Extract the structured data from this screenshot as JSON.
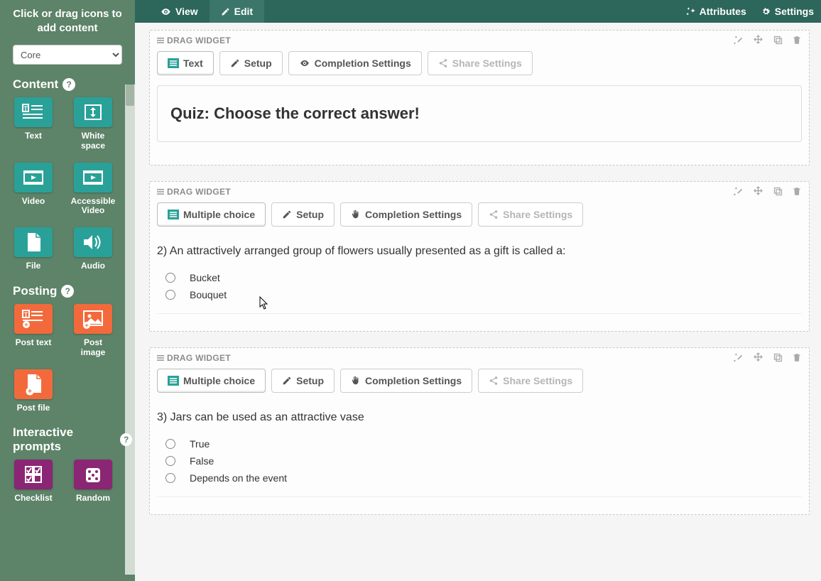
{
  "sidebar": {
    "header": "Click or drag icons to add content",
    "select_value": "Core",
    "sections": [
      {
        "title": "Content",
        "items": [
          {
            "label": "Text",
            "color": "teal"
          },
          {
            "label": "White space",
            "color": "teal"
          },
          {
            "label": "Video",
            "color": "teal"
          },
          {
            "label": "Accessible Video",
            "color": "teal"
          },
          {
            "label": "File",
            "color": "teal"
          },
          {
            "label": "Audio",
            "color": "teal"
          }
        ]
      },
      {
        "title": "Posting",
        "items": [
          {
            "label": "Post text",
            "color": "orange"
          },
          {
            "label": "Post image",
            "color": "orange"
          },
          {
            "label": "Post file",
            "color": "orange"
          }
        ]
      },
      {
        "title": "Interactive prompts",
        "items": [
          {
            "label": "Checklist",
            "color": "purple"
          },
          {
            "label": "Random",
            "color": "purple"
          }
        ]
      }
    ]
  },
  "topbar": {
    "view_label": "View",
    "edit_label": "Edit",
    "attributes_label": "Attributes",
    "settings_label": "Settings"
  },
  "widgets": [
    {
      "drag_label": "DRAG WIDGET",
      "tabs": [
        {
          "label": "Text",
          "icon": "text",
          "active": true
        },
        {
          "label": "Setup",
          "icon": "pencil"
        },
        {
          "label": "Completion Settings",
          "icon": "eye"
        },
        {
          "label": "Share Settings",
          "icon": "share",
          "disabled": true
        }
      ],
      "type": "text",
      "text": "Quiz: Choose the correct answer!"
    },
    {
      "drag_label": "DRAG WIDGET",
      "tabs": [
        {
          "label": "Multiple choice",
          "icon": "list",
          "active": true
        },
        {
          "label": "Setup",
          "icon": "pencil"
        },
        {
          "label": "Completion Settings",
          "icon": "hand"
        },
        {
          "label": "Share Settings",
          "icon": "share",
          "disabled": true
        }
      ],
      "type": "mc",
      "question": "2) An attractively arranged group of flowers usually presented as a gift is called a:",
      "options": [
        "Bucket",
        "Bouquet"
      ]
    },
    {
      "drag_label": "DRAG WIDGET",
      "tabs": [
        {
          "label": "Multiple choice",
          "icon": "list",
          "active": true
        },
        {
          "label": "Setup",
          "icon": "pencil"
        },
        {
          "label": "Completion Settings",
          "icon": "hand"
        },
        {
          "label": "Share Settings",
          "icon": "share",
          "disabled": true
        }
      ],
      "type": "mc",
      "question": "3) Jars can be used as an attractive vase",
      "options": [
        "True",
        "False",
        "Depends on the event"
      ]
    }
  ]
}
